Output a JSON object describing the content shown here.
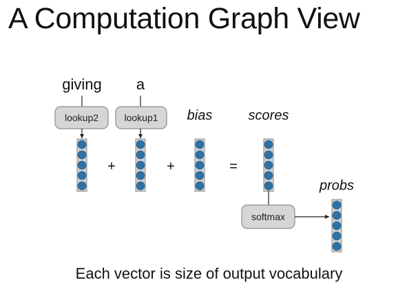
{
  "title": "A Computation Graph View",
  "inputs": {
    "word1": "giving",
    "word2": "a"
  },
  "functions": {
    "lookup2": "lookup2",
    "lookup1": "lookup1",
    "softmax": "softmax"
  },
  "vectors": {
    "bias": "bias",
    "scores": "scores",
    "probs": "probs"
  },
  "operators": {
    "plus": "+",
    "equals": "="
  },
  "caption": "Each vector is size of output vocabulary",
  "colors": {
    "vector_cell": "#2e72a5",
    "function_box": "#d6d6d6"
  }
}
